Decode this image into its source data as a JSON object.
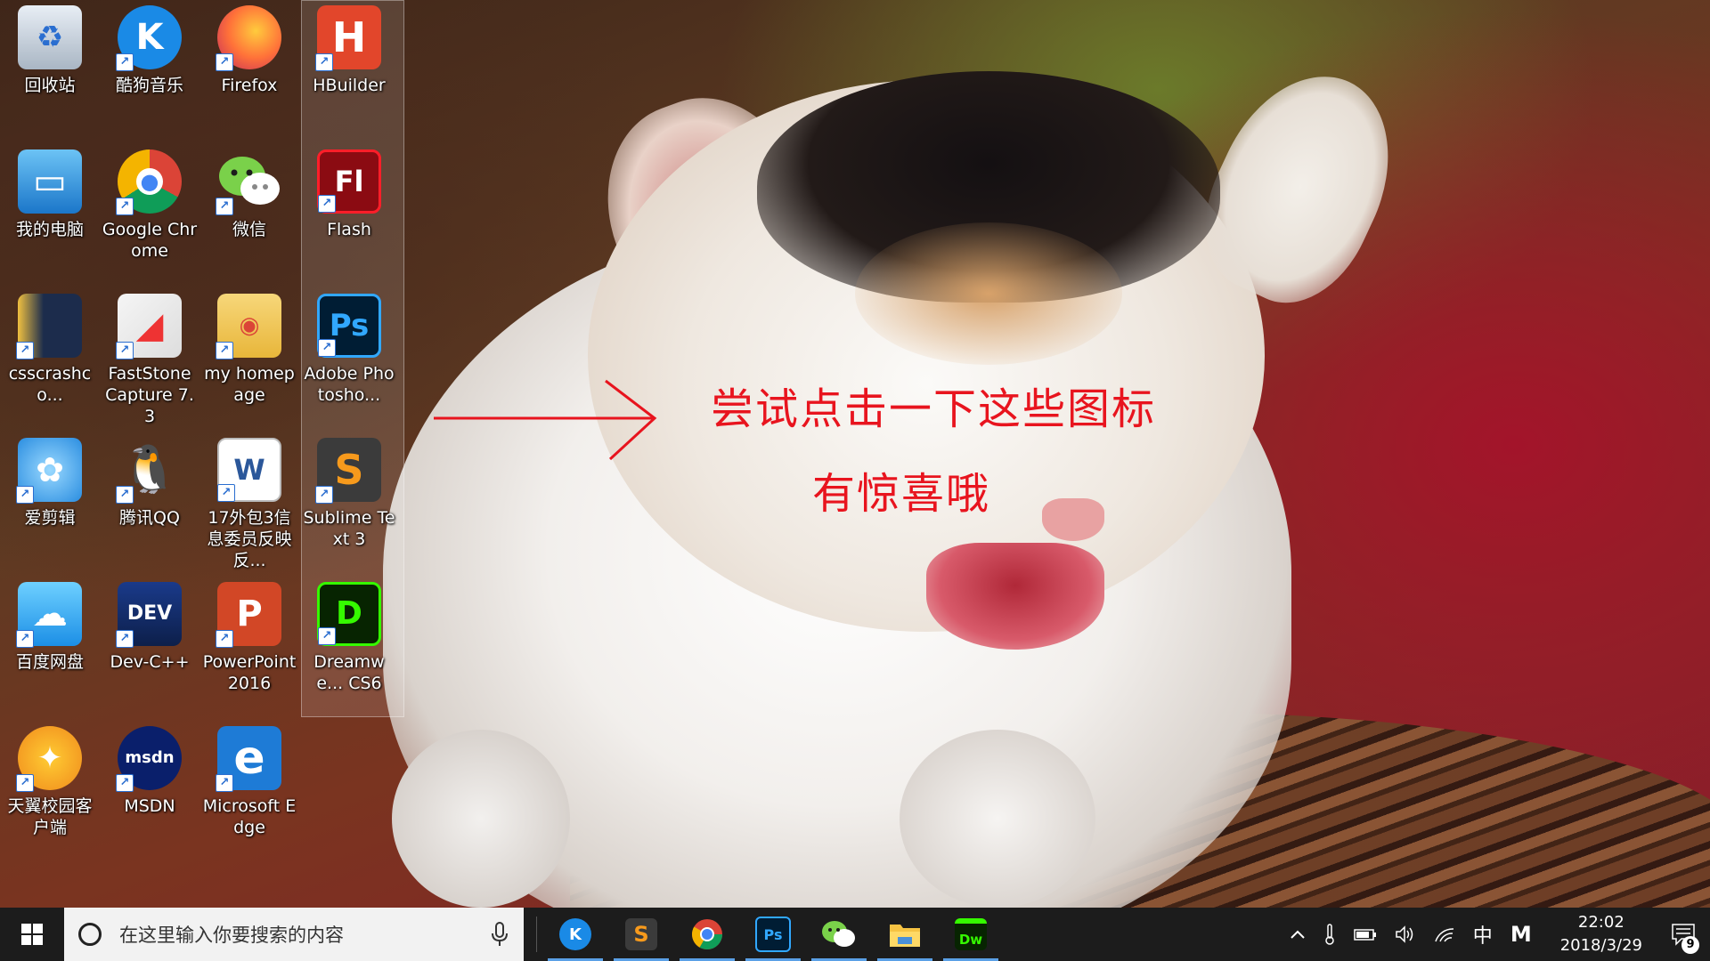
{
  "desktop": {
    "icons": [
      {
        "label": "回收站",
        "icon": "recycle-bin-icon"
      },
      {
        "label": "酷狗音乐",
        "icon": "kugou-music-icon"
      },
      {
        "label": "Firefox",
        "icon": "firefox-icon"
      },
      {
        "label": "HBuilder",
        "icon": "hbuilder-icon"
      },
      {
        "label": "我的电脑",
        "icon": "computer-icon"
      },
      {
        "label": "Google Chrome",
        "icon": "chrome-icon"
      },
      {
        "label": "微信",
        "icon": "wechat-icon"
      },
      {
        "label": "Flash",
        "icon": "flash-icon"
      },
      {
        "label": "csscrashco...",
        "icon": "book-icon"
      },
      {
        "label": "FastStone Capture 7.3",
        "icon": "faststone-icon"
      },
      {
        "label": "my homepage",
        "icon": "folder-chrome-icon"
      },
      {
        "label": "Adobe Photosho...",
        "icon": "photoshop-icon"
      },
      {
        "label": "爱剪辑",
        "icon": "aijianji-icon"
      },
      {
        "label": "腾讯QQ",
        "icon": "qq-icon"
      },
      {
        "label": "17外包3信息委员反映反...",
        "icon": "word-document-icon"
      },
      {
        "label": "Sublime Text 3",
        "icon": "sublime-text-icon"
      },
      {
        "label": "百度网盘",
        "icon": "baidu-netdisk-icon"
      },
      {
        "label": "Dev-C++",
        "icon": "dev-cpp-icon"
      },
      {
        "label": "PowerPoint 2016",
        "icon": "powerpoint-icon"
      },
      {
        "label": "Dreamwe... CS6",
        "icon": "dreamweaver-icon"
      },
      {
        "label": "天翼校园客户端",
        "icon": "tianyi-icon"
      },
      {
        "label": "MSDN",
        "icon": "msdn-icon"
      },
      {
        "label": "Microsoft Edge",
        "icon": "edge-icon"
      }
    ]
  },
  "annotation": {
    "line1": "尝试点击一下这些图标",
    "line2": "有惊喜哦",
    "color": "#e8141e"
  },
  "taskbar": {
    "search_placeholder": "在这里输入你要搜索的内容",
    "pinned_apps": [
      "kugou-music",
      "sublime-text",
      "chrome",
      "photoshop",
      "wechat",
      "file-explorer",
      "dreamweaver"
    ],
    "tray": {
      "ime_label": "中",
      "m_label": "M",
      "time": "22:02",
      "date": "2018/3/29",
      "notification_count": "9"
    }
  }
}
